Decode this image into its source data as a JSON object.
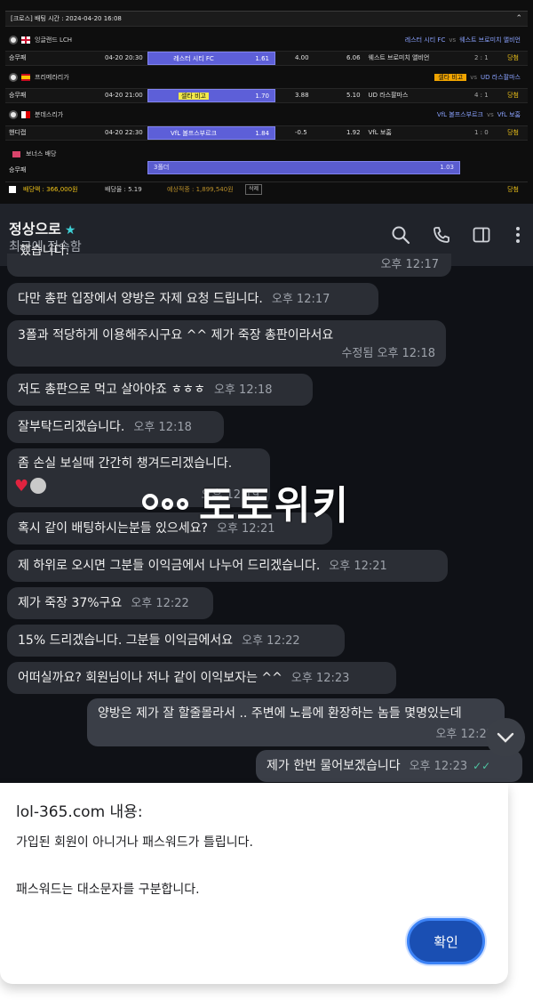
{
  "bet": {
    "header": "[크로스] 배팅 시간 : 2024-04-20 16:08",
    "leagues": [
      {
        "name": "잉글랜드 LCH",
        "home": "레스터 시티 FC",
        "vs": "vs",
        "away": "웨스트 브로미치 앨비언"
      },
      {
        "name": "프리메라리가",
        "home": "셀타 비고",
        "vs": "vs",
        "away": "UD 라스팔마스"
      },
      {
        "name": "분데스리가",
        "home": "VfL 볼프스부르크",
        "vs": "vs",
        "away": "VfL 보훔"
      }
    ],
    "games": [
      {
        "type": "승무패",
        "time": "04-20 20:30",
        "home": "레스터 시티 FC",
        "home_odds": "1.61",
        "draw": "4.00",
        "away_odds": "6.06",
        "away": "웨스트 브로미치 앨비언",
        "score": "2 : 1",
        "result": "당첨"
      },
      {
        "type": "승무패",
        "time": "04-20 21:00",
        "home": "셀타 비고",
        "home_odds": "1.70",
        "draw": "3.88",
        "away_odds": "5.10",
        "away": "UD 라스팔마스",
        "score": "4 : 1",
        "result": "당첨"
      },
      {
        "type": "핸디캡",
        "time": "04-20 22:30",
        "home": "VfL 볼프스부르크",
        "home_odds": "1.84",
        "draw": "-0.5",
        "away_odds": "1.92",
        "away": "VfL 보훔",
        "score": "1 : 0",
        "result": "당첨"
      }
    ],
    "bonus": {
      "label": "보너스 배당",
      "type": "승무패",
      "bar": "3폴더",
      "odds": "1.03"
    },
    "summary": {
      "amount": "배당액 : 366,000원",
      "odds": "배당율 : 5.19",
      "expected": "예상적중 : 1,899,540원",
      "delete": "삭제",
      "result": "당첨"
    }
  },
  "chat": {
    "contact": "정상으로",
    "status": "최근에 접속함",
    "messages": [
      {
        "text": "했습니다.",
        "time": "오후 12:17"
      },
      {
        "text": "다만 총판 입장에서  양방은 자제 요청 드립니다.",
        "time": "오후 12:17"
      },
      {
        "text": "3폴과 적당하게 이용해주시구요  ^^ 제가 죽장  총판이라서요",
        "time": "수정됨 오후 12:18"
      },
      {
        "text": "저도 총판으로 먹고 살아야죠 ㅎㅎㅎ",
        "time": "오후 12:18"
      },
      {
        "text": "잘부탁드리겠습니다.",
        "time": "오후 12:18"
      },
      {
        "text": "좀 손실 보실때 간간히 챙겨드리겠습니다.",
        "time": "오후 12:19"
      },
      {
        "text": "혹시  같이 배팅하시는분들 있으세요?",
        "time": "오후 12:21"
      },
      {
        "text": "제 하위로 오시면 그분들 이익금에서 나누어 드리겠습니다.",
        "time": "오후 12:21"
      },
      {
        "text": "제가 죽장 37%구요",
        "time": "오후 12:22"
      },
      {
        "text": "15% 드리겠습니다. 그분들  이익금에서요",
        "time": "오후 12:22"
      },
      {
        "text": "어떠실까요? 회원님이나 저나 같이  이익보자는 ^^",
        "time": "오후 12:23"
      },
      {
        "text": "양방은 제가 잘 할줄몰라서 .. 주변에 노름에 환장하는 놈들 몇명있는데",
        "time": "오후 12:22"
      },
      {
        "text": "제가 한번 물어보겠습니다",
        "time": "오후 12:23"
      }
    ],
    "watermark": "토토위키"
  },
  "dialog": {
    "title": "lol-365.com 내용:",
    "line1": "가입된 회원이 아니거나 패스워드가 틀립니다.",
    "line2": "패스워드는 대소문자를 구분합니다.",
    "ok": "확인"
  },
  "icons": {
    "search": "search-icon",
    "phone": "phone-icon",
    "sidebar": "sidebar-icon",
    "more": "more-vert-icon",
    "star": "star-icon",
    "chevron": "chevron-down-icon"
  },
  "colors": {
    "selection": "#5d5fd8",
    "win": "#f0c419",
    "chat_bg": "#0f1116",
    "bubble": "#2b2e35",
    "ok_button": "#1a4fb3"
  }
}
